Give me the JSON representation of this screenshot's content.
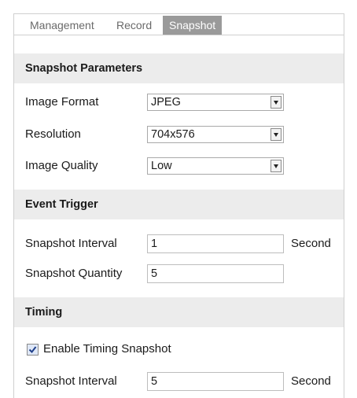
{
  "tabs": [
    {
      "label": "Management"
    },
    {
      "label": "Record"
    },
    {
      "label": "Snapshot",
      "active": true
    }
  ],
  "snapshot_parameters": {
    "title": "Snapshot Parameters",
    "image_format": {
      "label": "Image Format",
      "value": "JPEG"
    },
    "resolution": {
      "label": "Resolution",
      "value": "704x576"
    },
    "image_quality": {
      "label": "Image Quality",
      "value": "Low"
    }
  },
  "event_trigger": {
    "title": "Event Trigger",
    "snapshot_interval": {
      "label": "Snapshot Interval",
      "value": "1",
      "unit": "Second"
    },
    "snapshot_quantity": {
      "label": "Snapshot Quantity",
      "value": "5"
    }
  },
  "timing": {
    "title": "Timing",
    "enable_timing_snapshot": {
      "label": "Enable Timing Snapshot",
      "checked": true
    },
    "snapshot_interval": {
      "label": "Snapshot Interval",
      "value": "5",
      "unit": "Second"
    }
  },
  "colors": {
    "active_tab": "#9a9a9a",
    "section_header_bg": "#ececec",
    "border": "#cfcfcf"
  }
}
